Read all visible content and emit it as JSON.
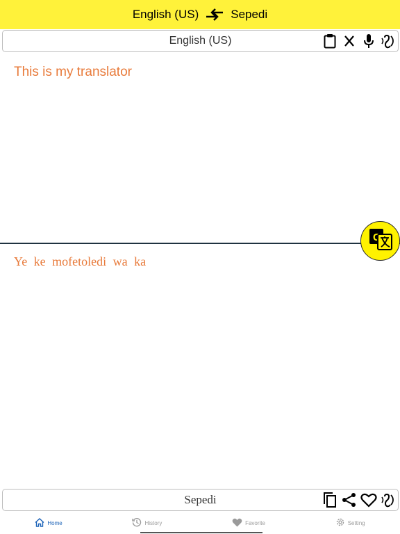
{
  "header": {
    "source_lang": "English (US)",
    "target_lang": "Sepedi"
  },
  "source_panel": {
    "lang_label": "English (US)",
    "text": "This is my translator",
    "icons": [
      "clipboard-icon",
      "close-icon",
      "microphone-icon",
      "speaker-icon"
    ]
  },
  "target_panel": {
    "lang_label": "Sepedi",
    "text": "Ye ke mofetoledi wa ka",
    "icons": [
      "copy-icon",
      "share-icon",
      "heart-icon",
      "speaker-icon"
    ]
  },
  "tabs": [
    {
      "label": "Home",
      "icon": "home-icon",
      "active": true
    },
    {
      "label": "History",
      "icon": "history-icon",
      "active": false
    },
    {
      "label": "Favorite",
      "icon": "heart-icon",
      "active": false
    },
    {
      "label": "Setting",
      "icon": "gear-icon",
      "active": false
    }
  ],
  "colors": {
    "header_bg": "#fff23a",
    "translated_text": "#e87a3a",
    "translate_button": "#fff200",
    "active_tab": "#1c63b8"
  }
}
